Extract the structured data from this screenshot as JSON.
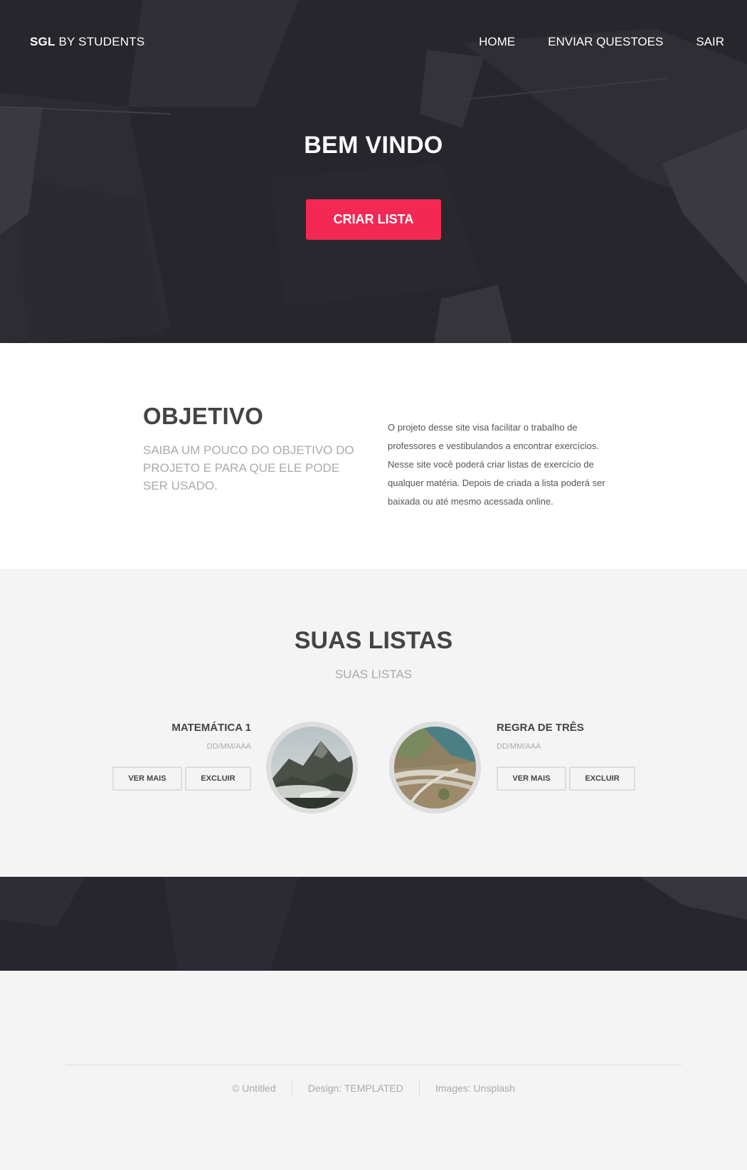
{
  "header": {
    "logo_bold": "SGL",
    "logo_rest": " BY STUDENTS",
    "nav": [
      {
        "label": "HOME"
      },
      {
        "label": "ENVIAR QUESTOES"
      },
      {
        "label": "SAIR"
      }
    ]
  },
  "hero": {
    "title": "BEM VINDO",
    "cta_label": "CRIAR LISTA",
    "cta_color": "#f32853"
  },
  "objetivo": {
    "title": "OBJETIVO",
    "subtitle": "SAIBA UM POUCO DO OBJETIVO DO PROJETO E PARA QUE ELE PODE SER USADO.",
    "body": "O projeto desse site visa facilitar o trabalho de professores e vestibulandos a encontrar exercícios. Nesse site você poderá criar listas de exercício de qualquer matéria. Depois de criada a lista poderá ser baixada ou até mesmo acessada online."
  },
  "listas": {
    "title": "SUAS LISTAS",
    "subtitle": "SUAS LISTAS",
    "items": [
      {
        "name": "MATEMÁTICA 1",
        "date": "DD/MM/AAA",
        "view_label": "VER MAIS",
        "delete_label": "EXCLUIR",
        "image": "mountain-photo"
      },
      {
        "name": "REGRA DE TRÊS",
        "date": "DD/MM/AAA",
        "view_label": "VER MAIS",
        "delete_label": "EXCLUIR",
        "image": "highway-aerial-photo"
      }
    ]
  },
  "footer": {
    "items": [
      "© Untitled",
      "Design: TEMPLATED",
      "Images: Unsplash"
    ]
  },
  "colors": {
    "dark_bg": "#27262c",
    "accent": "#f32853",
    "light_bg": "#f4f4f4"
  }
}
